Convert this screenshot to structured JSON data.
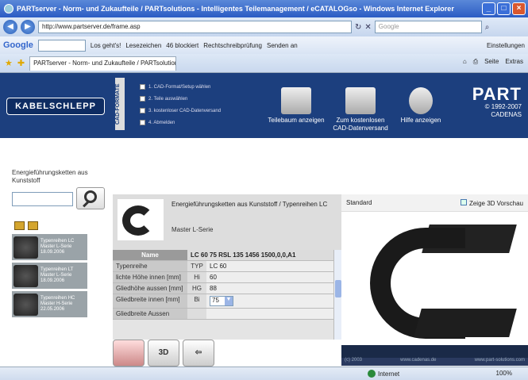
{
  "window": {
    "title": "PARTserver - Norm- und Zukaufteile / PARTsolutions - Intelligentes Teilemanagement / eCATALOGso - Windows Internet Explorer"
  },
  "address": {
    "url": "http://www.partserver.de/frame.asp",
    "search_placeholder": "Google"
  },
  "googlebar": {
    "logo": "Google",
    "items": [
      "Los geht's!",
      "Lesezeichen",
      "46 blockiert",
      "Rechtschreibprüfung",
      "Senden an",
      "Einstellungen"
    ]
  },
  "tabs": {
    "active_tab": "PARTserver - Norm- und Zukaufteile / PARTsolutions -...",
    "tools": [
      "Seite",
      "Extras"
    ]
  },
  "header": {
    "logo": "KABELSCHLEPP",
    "vertical_label": "CAD-FORMATE",
    "steps": [
      "1. CAD-Format/Setup wählen",
      "2. Teile auswählen",
      "3. kostenloser CAD-Datenversand",
      "4. Abmelden"
    ],
    "buttons": [
      {
        "label": "Teilebaum anzeigen"
      },
      {
        "label": "Zum kostenlosen CAD-Datenversand"
      },
      {
        "label": "Hilfe anzeigen"
      }
    ],
    "brand_big": "PART",
    "brand_copyright": "© 1992-2007",
    "brand_sub": "CADENAS"
  },
  "sidebar": {
    "label": "Energieführungsketten aus Kunststoff",
    "results": [
      {
        "line1": "Typenreihen LC",
        "line2": "Master L-Serie",
        "line3": "18.09.2006"
      },
      {
        "line1": "Typenreihen LT",
        "line2": "Master L-Serie",
        "line3": "18.09.2006"
      },
      {
        "line1": "Typenreihen HC",
        "line2": "Master H-Serie",
        "line3": "22.05.2006"
      }
    ]
  },
  "detail": {
    "title": "Energieführungsketten aus Kunststoff / Typenreihen LC",
    "subtitle": "Master L-Serie",
    "table_header": {
      "label": "Name",
      "value": "LC 60 75 RSL 135 1456 1500,0,0,A1"
    },
    "rows": [
      {
        "label": "Typenreihe",
        "key": "TYP",
        "value": "LC 60"
      },
      {
        "label": "lichte Höhe innen [mm]",
        "key": "Hi",
        "value": "60"
      },
      {
        "label": "Gliedhöhe aussen [mm]",
        "key": "HG",
        "value": "88"
      },
      {
        "label": "Gliedbreite innen [mm]",
        "key": "Bi",
        "value": "75"
      },
      {
        "label": "Gliedbreite Aussen",
        "key": "",
        "value": ""
      }
    ],
    "bottom_buttons": [
      "3D"
    ]
  },
  "viewer": {
    "mode": "Standard",
    "checkbox_label": "Zeige 3D Vorschau",
    "status_left": "(c) 2003",
    "status_mid": "www.cadenas.de",
    "status_right": "www.part-solutions.com"
  },
  "statusbar": {
    "zone": "Internet",
    "zoom": "100%"
  },
  "colors": {
    "header_bg": "#1c3f7e",
    "titlebar": "#2b5cc4"
  }
}
